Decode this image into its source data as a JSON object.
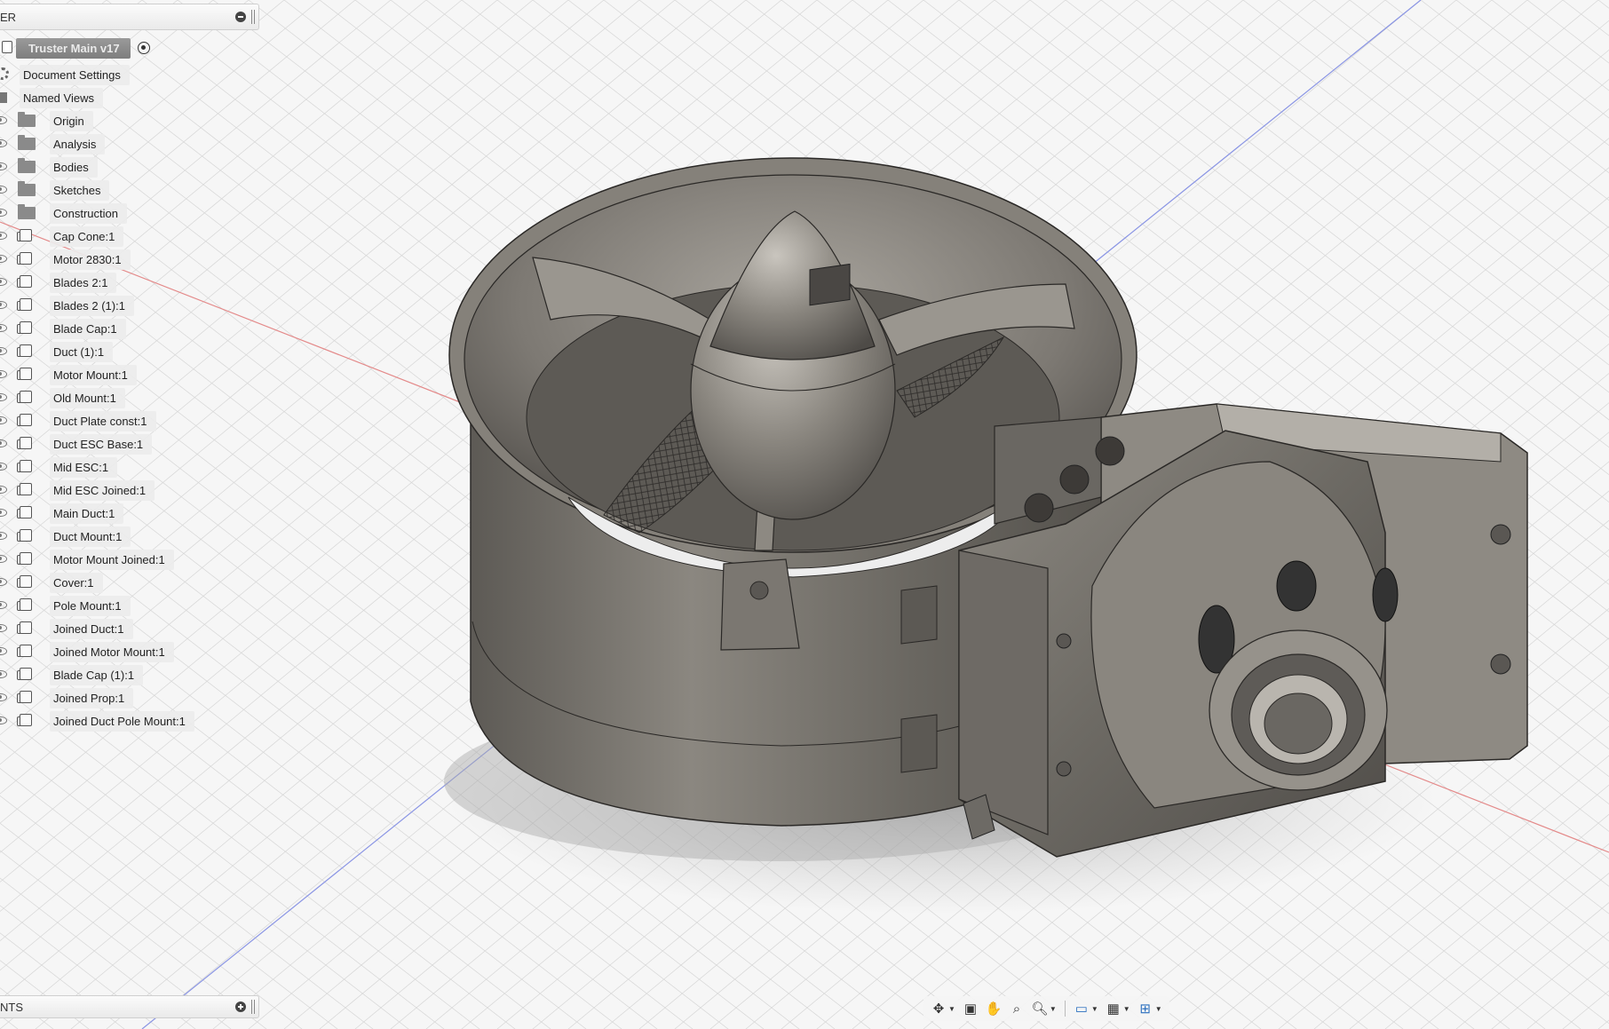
{
  "browser": {
    "title": "ER",
    "document": "Truster Main v17",
    "top_items": [
      {
        "label": "Document Settings",
        "icon": "gear-icon"
      },
      {
        "label": "Named Views",
        "icon": "views-icon"
      }
    ],
    "folders": [
      "Origin",
      "Analysis",
      "Bodies",
      "Sketches",
      "Construction"
    ],
    "components": [
      "Cap Cone:1",
      "Motor 2830:1",
      "Blades 2:1",
      "Blades 2 (1):1",
      "Blade Cap:1",
      "Duct (1):1",
      "Motor Mount:1",
      "Old Mount:1",
      "Duct Plate const:1",
      "Duct ESC Base:1",
      "Mid ESC:1",
      "Mid ESC Joined:1",
      "Main Duct:1",
      "Duct Mount:1",
      "Motor Mount Joined:1",
      "Cover:1",
      "Pole Mount:1",
      "Joined Duct:1",
      "Joined Motor Mount:1",
      "Blade Cap (1):1",
      "Joined Prop:1",
      "Joined Duct Pole Mount:1"
    ]
  },
  "comments": {
    "title": "NTS"
  },
  "navbar": {
    "tools": [
      "orbit-icon",
      "look-at-icon",
      "pan-icon",
      "zoom-icon",
      "zoom-window-icon",
      "display-icon",
      "grid-icon",
      "viewports-icon"
    ]
  },
  "colors": {
    "model": "#6f6b65",
    "grid": "#d6d6d6",
    "x_axis": "#e05a5a",
    "y_axis": "#5a6ee0",
    "accent": "#2a6fbf"
  }
}
